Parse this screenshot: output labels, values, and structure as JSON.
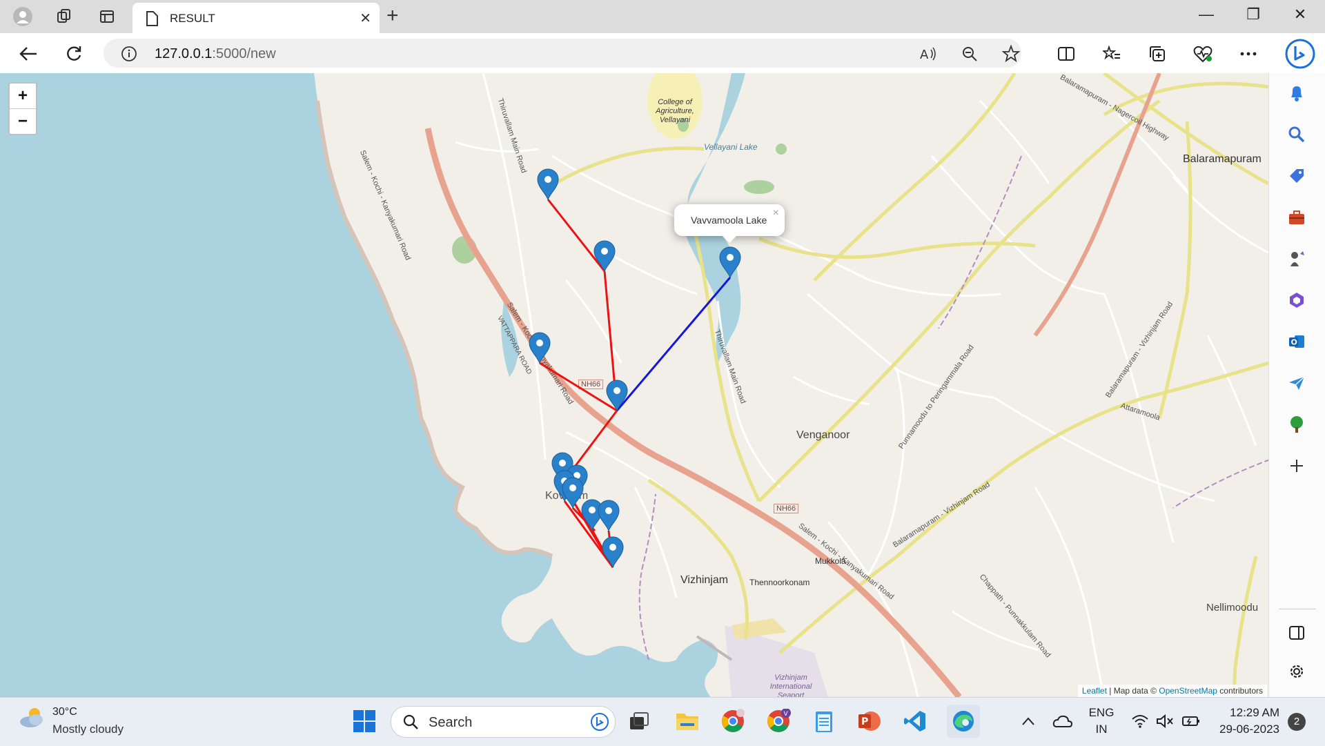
{
  "browser": {
    "tab_title": "RESULT",
    "url_host": "127.0.0.1",
    "url_path": ":5000/new",
    "new_tab_symbol": "+",
    "window_controls": [
      "—",
      "❐",
      "✕"
    ]
  },
  "map": {
    "zoom_in": "+",
    "zoom_out": "−",
    "popup_text": "Vavvamoola Lake",
    "popup_close": "×",
    "attribution": {
      "leaflet": "Leaflet",
      "sep1": " | Map data © ",
      "osm": "OpenStreetMap",
      "tail": " contributors"
    },
    "labels": {
      "college": "College of Agriculture, Vellayani",
      "vellayani_lake": "Vellayani Lake",
      "balaramapuram": "Balaramapuram",
      "venganoor": "Venganoor",
      "vizhinjam": "Vizhinjam",
      "mukkola": "Mukkola",
      "thennoorkonam": "Thennoorkonam",
      "nellimoodu": "Nellimoodu",
      "kovalam": "Kovalam",
      "nh66_a": "NH66",
      "nh66_b": "NH66",
      "road_salem_top": "Salem - Kochi - Kanyakumari Road",
      "road_salem_mid": "Salem - Kochi - Kanyakumari Road",
      "road_salem_low": "Salem - Kochi - Kanyakumari Road",
      "road_thiruvallam": "Thiruvallam Main Road",
      "road_vattappara": "VATTAPPARA ROAD",
      "road_punnamoodu": "Punnamoodu to Peringammala Road",
      "road_attaramoola": "Attaramoola",
      "road_vizhinjam": "Balaramapuram - Vizhinjam Road",
      "road_chappath": "Chappath - Punnakkulam Road",
      "road_nagercoil": "Balaramapuram - Nagercoil Highway",
      "port": "Vizhinjam International Seaport"
    },
    "route_colors": {
      "red": "#ee1111",
      "blue": "#1515dd",
      "marker": "#2a81cb"
    }
  },
  "taskbar": {
    "temperature": "30°C",
    "weather": "Mostly cloudy",
    "search_placeholder": "Search",
    "language_top": "ENG",
    "language_bottom": "IN",
    "time": "12:29 AM",
    "date": "29-06-2023",
    "notification_count": "2"
  }
}
